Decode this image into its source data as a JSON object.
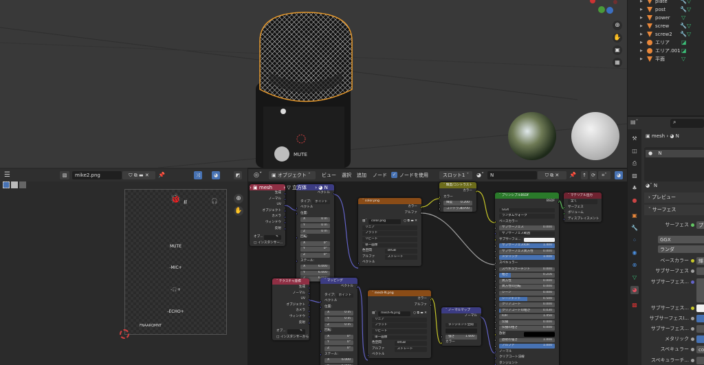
{
  "viewport": {
    "mic_label": "MUTE",
    "nav_icons": [
      "zoom-icon",
      "hand-icon",
      "camera-icon",
      "grid-icon"
    ]
  },
  "outliner": {
    "items": [
      {
        "name": "plate",
        "type": "mesh"
      },
      {
        "name": "post",
        "type": "mesh"
      },
      {
        "name": "power",
        "type": "mesh"
      },
      {
        "name": "screw",
        "type": "mesh"
      },
      {
        "name": "screw2",
        "type": "mesh"
      },
      {
        "name": "エリア",
        "type": "light"
      },
      {
        "name": "エリア.001",
        "type": "light"
      },
      {
        "name": "平面",
        "type": "mesh"
      }
    ]
  },
  "properties": {
    "breadcrumb": [
      "mesh",
      "N"
    ],
    "slot_name": "N",
    "material_name": "N",
    "preview_label": "プレビュー",
    "surface_panel": "サーフェス",
    "rows": [
      {
        "label": "サーフェス",
        "socket": "#63c763",
        "value": "プ"
      },
      {
        "label": "",
        "socket": "",
        "value": "GGX"
      },
      {
        "label": "",
        "socket": "",
        "value": "ランダ"
      },
      {
        "label": "ベースカラー",
        "socket": "#c7c729",
        "value": "輝"
      },
      {
        "label": "サブサーフェス",
        "socket": "#a1a1a1",
        "value": ""
      },
      {
        "label": "サブサーフェス...",
        "socket": "#6363c7",
        "value": ""
      },
      {
        "label": "サブサーフェス...",
        "socket": "#c7c729",
        "value": ""
      },
      {
        "label": "サブサーフェスI...",
        "socket": "#a1a1a1",
        "value": ""
      },
      {
        "label": "サブサーフェス...",
        "socket": "#a1a1a1",
        "value": ""
      },
      {
        "label": "メタリック",
        "socket": "#a1a1a1",
        "value": ""
      },
      {
        "label": "スペキュラー",
        "socket": "#a1a1a1",
        "value": "col"
      },
      {
        "label": "スペキュラーチ...",
        "socket": "#a1a1a1",
        "value": ""
      }
    ]
  },
  "image_editor": {
    "image_name": "mike2.png",
    "texture_texts": {
      "mute": "MUTE",
      "mic": "-MIC+",
      "phones": "-🎧+",
      "echo": "-ECHO+",
      "brand": "FNAARQMNT"
    }
  },
  "node_editor": {
    "header": {
      "mode": "オブジェクト",
      "menus": [
        "ビュー",
        "選択",
        "追加",
        "ノード"
      ],
      "use_nodes": "ノードを使用",
      "slot": "スロット1",
      "material": "N"
    },
    "breadcrumb": [
      "mesh",
      "立方体",
      "N"
    ],
    "socket_colors": {
      "float": "#a1a1a1",
      "color": "#c7c729",
      "vector": "#6363c7",
      "shader": "#63c763"
    },
    "nodes": {
      "tc1": {
        "title": "",
        "color": "#8f2f44",
        "rows": [
          {
            "t": "out",
            "l": "生成",
            "s": "vector"
          },
          {
            "t": "out",
            "l": "ノーマル",
            "s": "vector"
          },
          {
            "t": "out",
            "l": "UV",
            "s": "vector"
          },
          {
            "t": "out",
            "l": "オブジェクト",
            "s": "vector"
          },
          {
            "t": "out",
            "l": "カメラ",
            "s": "vector"
          },
          {
            "t": "out",
            "l": "ウィンドウ",
            "s": "vector"
          },
          {
            "t": "out",
            "l": "反射",
            "s": "vector"
          },
          {
            "t": "gap"
          },
          {
            "t": "obj",
            "l": "オブ..."
          },
          {
            "t": "check",
            "l": "インスタンサー..."
          }
        ]
      },
      "map1": {
        "title": "",
        "color": "#3c3c83",
        "rows": [
          {
            "t": "out",
            "l": "ベクトル",
            "s": "vector"
          },
          {
            "t": "gap"
          },
          {
            "t": "select",
            "l": "タイプ:",
            "v": "ポイント"
          },
          {
            "t": "in",
            "l": "ベクトル",
            "s": "vector"
          },
          {
            "t": "in",
            "l": "位置:",
            "s": "vector"
          },
          {
            "t": "field",
            "l": "X",
            "v": "0 m"
          },
          {
            "t": "field",
            "l": "Y",
            "v": "0 m"
          },
          {
            "t": "field",
            "l": "Z",
            "v": "0 m"
          },
          {
            "t": "in",
            "l": "回転:",
            "s": "vector"
          },
          {
            "t": "field",
            "l": "X",
            "v": "0°"
          },
          {
            "t": "field",
            "l": "Y",
            "v": "0°"
          },
          {
            "t": "field",
            "l": "Z",
            "v": "0°"
          },
          {
            "t": "in",
            "l": "ステール:",
            "s": "vector"
          },
          {
            "t": "field",
            "l": "X",
            "v": "6.000"
          },
          {
            "t": "field",
            "l": "Y",
            "v": "6.000"
          },
          {
            "t": "field",
            "l": "Z",
            "v": "6.000"
          }
        ]
      },
      "color": {
        "title": "color.png",
        "color": "#8a4c17",
        "rows": [
          {
            "t": "out",
            "l": "カラー",
            "s": "color"
          },
          {
            "t": "out",
            "l": "アルファ",
            "s": "float"
          },
          {
            "t": "gap"
          },
          {
            "t": "image",
            "v": "color.png"
          },
          {
            "t": "select",
            "v": "リニア"
          },
          {
            "t": "select",
            "v": "フラット"
          },
          {
            "t": "select",
            "v": "リピート"
          },
          {
            "t": "select",
            "v": "単一画像"
          },
          {
            "t": "select",
            "l": "色空間",
            "v": "sRGB"
          },
          {
            "t": "select",
            "l": "アルファ",
            "v": "ストレート"
          },
          {
            "t": "in",
            "l": "ベクトル",
            "s": "vector"
          }
        ]
      },
      "bc": {
        "title": "輝度/コントラスト",
        "color": "#6c6c1b",
        "rows": [
          {
            "t": "out",
            "l": "カラー",
            "s": "color"
          },
          {
            "t": "in",
            "l": "カラー",
            "s": "color"
          },
          {
            "t": "field",
            "l": "輝度",
            "v": "0.200",
            "s": "float"
          },
          {
            "t": "field",
            "l": "コントラスト",
            "v": "4.700",
            "s": "float"
          }
        ]
      },
      "bsdf": {
        "title": "プリンシプルBSDF",
        "color": "#2a7a2a",
        "rows": [
          {
            "t": "out",
            "l": "BSDF",
            "s": "shader"
          },
          {
            "t": "gap"
          },
          {
            "t": "select",
            "v": "GGX"
          },
          {
            "t": "select",
            "v": "ランダムウォーク"
          },
          {
            "t": "in",
            "l": "ベースカラー",
            "s": "color"
          },
          {
            "t": "field",
            "l": "サブサーフェス",
            "v": "0.000",
            "s": "float"
          },
          {
            "t": "select",
            "l": "",
            "v": "サブサーフェス範囲",
            "s": "vector"
          },
          {
            "t": "colorf",
            "l": "サブサーフェ...",
            "v": "#f2f2f2",
            "s": "color"
          },
          {
            "t": "field",
            "l": "サブサーフェスIOR",
            "v": "1.400",
            "s": "float",
            "f": 1
          },
          {
            "t": "field",
            "l": "サブサーフェス異方性",
            "v": "0.000",
            "s": "float"
          },
          {
            "t": "field",
            "l": "メタリック",
            "v": "1.000",
            "s": "float",
            "f": 1
          },
          {
            "t": "in",
            "l": "スペキュラー",
            "s": "float"
          },
          {
            "t": "field",
            "l": "スペキュラーチント",
            "v": "0.000",
            "s": "float"
          },
          {
            "t": "field",
            "l": "粗さ",
            "v": "0.216",
            "s": "float",
            "f": 0.216
          },
          {
            "t": "field",
            "l": "異方性",
            "v": "0.000",
            "s": "float"
          },
          {
            "t": "field",
            "l": "異方性の回転",
            "v": "0.000",
            "s": "float"
          },
          {
            "t": "field",
            "l": "シーン",
            "v": "0.000",
            "s": "float"
          },
          {
            "t": "field",
            "l": "シーンチント",
            "v": "0.500",
            "s": "float",
            "f": 0.5
          },
          {
            "t": "field",
            "l": "クリアコート",
            "v": "0.000",
            "s": "float"
          },
          {
            "t": "field",
            "l": "クリアコートの粗さ",
            "v": "0.030",
            "s": "float",
            "f": 0.03
          },
          {
            "t": "field",
            "l": "IOR",
            "v": "1.450",
            "s": "float"
          },
          {
            "t": "field",
            "l": "伝播",
            "v": "0.000",
            "s": "float"
          },
          {
            "t": "field",
            "l": "伝播の粗さ",
            "v": "0.000",
            "s": "float"
          },
          {
            "t": "colorf",
            "l": "放射",
            "v": "#000000",
            "s": "color"
          },
          {
            "t": "field",
            "l": "放射の強さ",
            "v": "1.000",
            "s": "float"
          },
          {
            "t": "field",
            "l": "アルファ",
            "v": "1.000",
            "s": "float",
            "f": 1
          },
          {
            "t": "in",
            "l": "ノーマル",
            "s": "vector"
          },
          {
            "t": "in",
            "l": "クリアコート法線",
            "s": "vector"
          },
          {
            "t": "in",
            "l": "タンジェント",
            "s": "vector"
          }
        ]
      },
      "mout": {
        "title": "マテリアル出力",
        "color": "#6e2230",
        "rows": [
          {
            "t": "select",
            "v": "全て"
          },
          {
            "t": "in",
            "l": "サーフェス",
            "s": "shader"
          },
          {
            "t": "in",
            "l": "ボリューム",
            "s": "shader"
          },
          {
            "t": "in",
            "l": "ディスプレイスメント",
            "s": "vector"
          }
        ]
      },
      "tc2": {
        "title": "テクスチャ座標",
        "color": "#8f2f44",
        "rows": [
          {
            "t": "out",
            "l": "生成",
            "s": "vector"
          },
          {
            "t": "out",
            "l": "ノーマル",
            "s": "vector"
          },
          {
            "t": "out",
            "l": "UV",
            "s": "vector"
          },
          {
            "t": "out",
            "l": "オブジェクト",
            "s": "vector"
          },
          {
            "t": "out",
            "l": "カメラ",
            "s": "vector"
          },
          {
            "t": "out",
            "l": "ウィンドウ",
            "s": "vector"
          },
          {
            "t": "out",
            "l": "反射",
            "s": "vector"
          },
          {
            "t": "gap"
          },
          {
            "t": "obj",
            "l": "オブ..."
          },
          {
            "t": "check",
            "l": "インスタンサーから"
          }
        ]
      },
      "map2": {
        "title": "マッピング",
        "color": "#3c3c83",
        "rows": [
          {
            "t": "out",
            "l": "ベクトル",
            "s": "vector"
          },
          {
            "t": "gap"
          },
          {
            "t": "select",
            "l": "タイプ:",
            "v": "ポイント"
          },
          {
            "t": "in",
            "l": "ベクトル",
            "s": "vector"
          },
          {
            "t": "in",
            "l": "位置:",
            "s": "vector"
          },
          {
            "t": "field",
            "l": "X",
            "v": "0 m"
          },
          {
            "t": "field",
            "l": "Y",
            "v": "0 m"
          },
          {
            "t": "field",
            "l": "Z",
            "v": "0 m"
          },
          {
            "t": "in",
            "l": "回転:",
            "s": "vector"
          },
          {
            "t": "field",
            "l": "X",
            "v": "0°"
          },
          {
            "t": "field",
            "l": "Y",
            "v": "0°"
          },
          {
            "t": "field",
            "l": "Z",
            "v": "0°"
          },
          {
            "t": "in",
            "l": "ステール:",
            "s": "vector"
          },
          {
            "t": "field",
            "l": "X",
            "v": "6.000"
          },
          {
            "t": "field",
            "l": "Y",
            "v": "6.000"
          }
        ]
      },
      "meshN": {
        "title": "mesh-N.png",
        "color": "#8a4c17",
        "rows": [
          {
            "t": "out",
            "l": "カラー",
            "s": "color"
          },
          {
            "t": "out",
            "l": "アルファ",
            "s": "float"
          },
          {
            "t": "gap"
          },
          {
            "t": "image",
            "v": "mesh-N.png"
          },
          {
            "t": "select",
            "v": "リニア"
          },
          {
            "t": "select",
            "v": "フラット"
          },
          {
            "t": "select",
            "v": "リピート"
          },
          {
            "t": "select",
            "v": "単一画像"
          },
          {
            "t": "select",
            "l": "色空間",
            "v": "sRGB"
          },
          {
            "t": "select",
            "l": "アルファ",
            "v": "ストレート"
          },
          {
            "t": "in",
            "l": "ベクトル",
            "s": "vector"
          }
        ]
      },
      "nmap": {
        "title": "ノーマルマップ",
        "color": "#3c3c83",
        "rows": [
          {
            "t": "out",
            "l": "ノーマル",
            "s": "vector"
          },
          {
            "t": "gap"
          },
          {
            "t": "select",
            "v": "タンジェント空間"
          },
          {
            "t": "select",
            "v": "",
            "plain": true
          },
          {
            "t": "field",
            "l": "強さ",
            "v": "1.600",
            "s": "float"
          },
          {
            "t": "in",
            "l": "カラー",
            "s": "color"
          }
        ]
      }
    }
  }
}
